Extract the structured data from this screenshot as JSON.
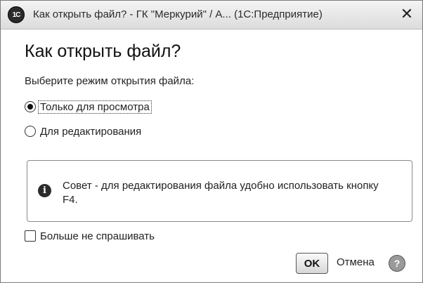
{
  "window": {
    "app_icon_text": "1C",
    "title": "Как открыть файл? - ГК \"Меркурий\" / А... (1С:Предприятие)",
    "close_glyph": "✕"
  },
  "dialog": {
    "heading": "Как открыть файл?",
    "prompt": "Выберите режим открытия файла:",
    "options": [
      {
        "label": "Только для просмотра",
        "checked": true
      },
      {
        "label": "Для редактирования",
        "checked": false
      }
    ],
    "hint": {
      "icon_glyph": "i",
      "text": "Совет - для редактирования файла удобно использовать кнопку F4."
    },
    "dont_ask": {
      "label": "Больше не спрашивать",
      "checked": false
    }
  },
  "buttons": {
    "ok_label": "OK",
    "cancel_label": "Отмена",
    "help_glyph": "?"
  },
  "icons": {
    "app": "1c-logo-icon",
    "close": "close-icon",
    "info": "info-icon",
    "help": "help-icon"
  }
}
